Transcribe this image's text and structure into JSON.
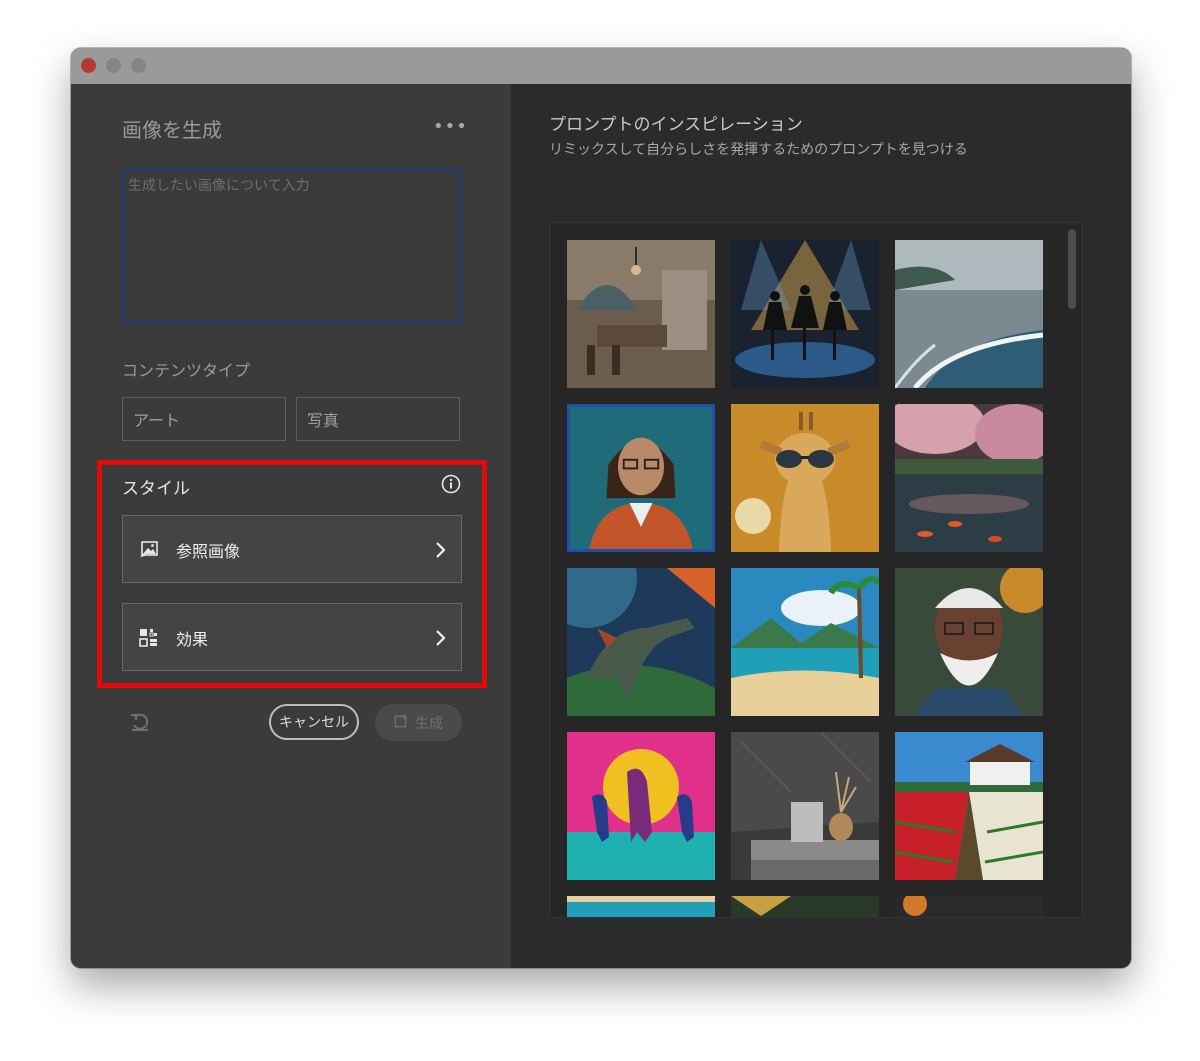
{
  "left_panel": {
    "title": "画像を生成",
    "more_label": "•••",
    "prompt_placeholder": "生成したい画像について入力",
    "content_type": {
      "label": "コンテンツタイプ",
      "options": [
        "アート",
        "写真"
      ]
    },
    "style": {
      "label": "スタイル",
      "rows": [
        {
          "label": "参照画像",
          "icon": "reference-image-icon"
        },
        {
          "label": "効果",
          "icon": "effects-icon"
        }
      ],
      "highlight_color": "#e00b0b"
    },
    "actions": {
      "cancel_label": "キャンセル",
      "generate_label": "生成"
    }
  },
  "right_panel": {
    "title": "プロンプトのインスピレーション",
    "subtitle": "リミックスして自分らしさを発揮するためのプロンプトを見つける",
    "gallery": [
      {
        "subject": "kitchen-interior"
      },
      {
        "subject": "ballet-dancers-stage"
      },
      {
        "subject": "ocean-beach-waves"
      },
      {
        "subject": "woman-with-glasses-portrait",
        "selected": true
      },
      {
        "subject": "giraffe-with-sunglasses"
      },
      {
        "subject": "cherry-blossom-koi-pond"
      },
      {
        "subject": "dinosaur-jungle"
      },
      {
        "subject": "tropical-beach-palm"
      },
      {
        "subject": "old-man-white-beard-portrait"
      },
      {
        "subject": "neon-horses-sunset"
      },
      {
        "subject": "marble-vase-still-life"
      },
      {
        "subject": "tulip-field-farmhouse"
      },
      {
        "subject": "partial-thumbnail-1"
      },
      {
        "subject": "partial-thumbnail-2"
      },
      {
        "subject": "partial-thumbnail-3"
      }
    ]
  },
  "colors": {
    "accent_blue": "#1f4fa8",
    "highlight_red": "#e00b0b"
  }
}
